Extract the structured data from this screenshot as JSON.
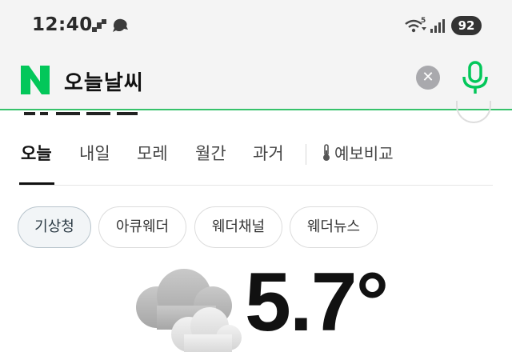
{
  "status_bar": {
    "time": "12:40",
    "wifi_badge": "5",
    "battery": "92"
  },
  "search": {
    "logo": "N",
    "query": "오늘날씨",
    "clear_icon": "close-icon",
    "mic_icon": "mic-icon",
    "accent_color": "#03c75a"
  },
  "tabs": [
    {
      "label": "오늘",
      "active": true
    },
    {
      "label": "내일",
      "active": false
    },
    {
      "label": "모레",
      "active": false
    },
    {
      "label": "월간",
      "active": false
    },
    {
      "label": "과거",
      "active": false
    }
  ],
  "forecast_compare": {
    "label": "예보비교",
    "icon": "thermometer-icon"
  },
  "sources": [
    {
      "label": "기상청",
      "selected": true
    },
    {
      "label": "아큐웨더",
      "selected": false
    },
    {
      "label": "웨더채널",
      "selected": false
    },
    {
      "label": "웨더뉴스",
      "selected": false
    }
  ],
  "weather": {
    "icon": "cloudy-icon",
    "temperature": "5.7°"
  }
}
